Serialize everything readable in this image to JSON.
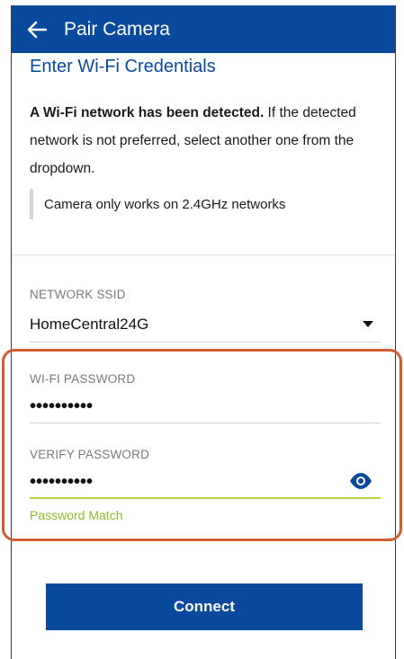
{
  "header": {
    "back_icon": "arrow-left-icon",
    "title": "Pair Camera"
  },
  "subtitle": "Enter Wi-Fi Credentials",
  "intro": {
    "bold": "A Wi-Fi network has been detected.",
    "rest": " If the detected network is not preferred, select another one from the dropdown."
  },
  "note": "Camera only works on 2.4GHz networks",
  "network": {
    "label": "NETWORK SSID",
    "value": "HomeCentral24G",
    "dropdown_icon": "caret-down-icon"
  },
  "wifi_password": {
    "label": "WI-FI PASSWORD",
    "masked_value": "••••••••••"
  },
  "verify_password": {
    "label": "VERIFY PASSWORD",
    "masked_value": "••••••••••",
    "toggle_icon": "eye-icon",
    "status": "Password Match"
  },
  "connect_label": "Connect",
  "colors": {
    "primary": "#0a4a9e",
    "success": "#8cbc2a",
    "highlight": "#cf5f32"
  }
}
